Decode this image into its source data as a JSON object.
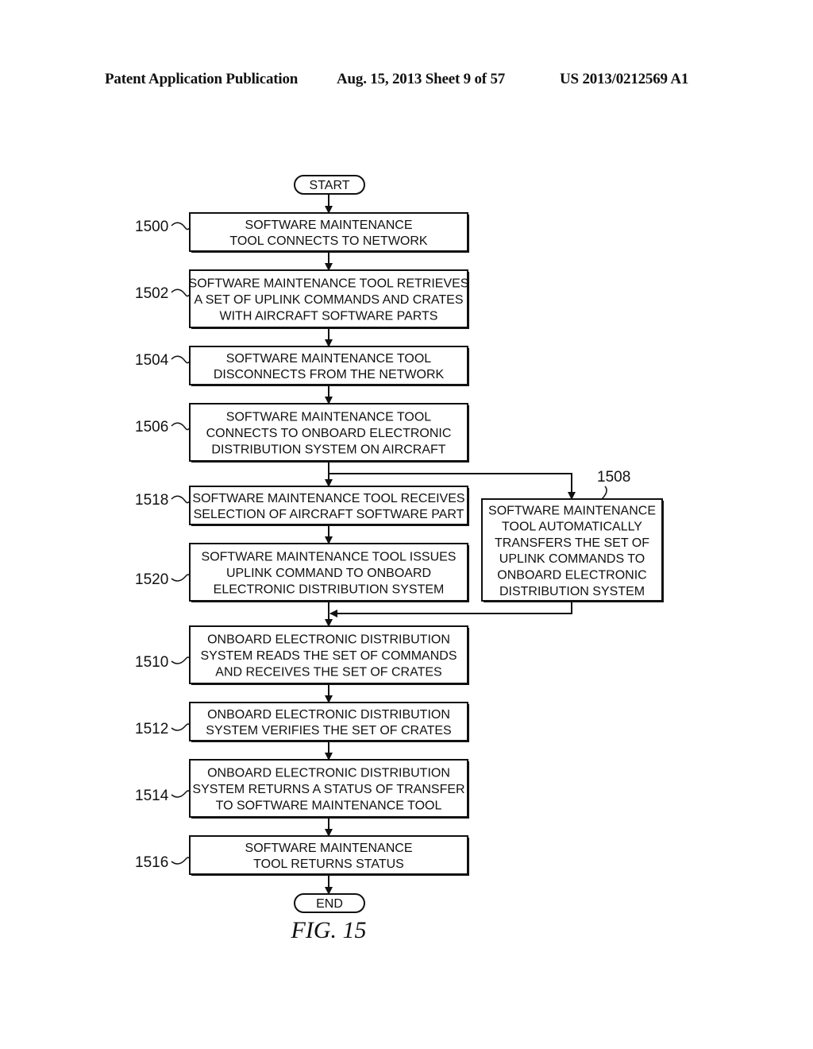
{
  "header": {
    "publication": "Patent Application Publication",
    "date_sheet": "Aug. 15, 2013  Sheet 9 of 57",
    "number": "US 2013/0212569 A1"
  },
  "figure_label": "FIG. 15",
  "terminals": {
    "start": "START",
    "end": "END"
  },
  "steps": [
    {
      "ref": "1500",
      "lines": [
        "SOFTWARE MAINTENANCE",
        "TOOL CONNECTS TO NETWORK"
      ]
    },
    {
      "ref": "1502",
      "lines": [
        "SOFTWARE MAINTENANCE TOOL RETRIEVES",
        "A SET OF UPLINK COMMANDS AND CRATES",
        "WITH AIRCRAFT SOFTWARE PARTS"
      ]
    },
    {
      "ref": "1504",
      "lines": [
        "SOFTWARE MAINTENANCE TOOL",
        "DISCONNECTS FROM THE NETWORK"
      ]
    },
    {
      "ref": "1506",
      "lines": [
        "SOFTWARE MAINTENANCE TOOL",
        "CONNECTS TO ONBOARD ELECTRONIC",
        "DISTRIBUTION SYSTEM ON AIRCRAFT"
      ]
    },
    {
      "ref": "1518",
      "lines": [
        "SOFTWARE MAINTENANCE TOOL RECEIVES",
        "SELECTION OF AIRCRAFT SOFTWARE PART"
      ]
    },
    {
      "ref": "1520",
      "lines": [
        "SOFTWARE MAINTENANCE TOOL ISSUES",
        "UPLINK COMMAND TO ONBOARD",
        "ELECTRONIC DISTRIBUTION SYSTEM"
      ]
    },
    {
      "ref": "1508",
      "lines": [
        "SOFTWARE MAINTENANCE",
        "TOOL AUTOMATICALLY",
        "TRANSFERS THE SET OF",
        "UPLINK COMMANDS TO",
        "ONBOARD ELECTRONIC",
        "DISTRIBUTION SYSTEM"
      ]
    },
    {
      "ref": "1510",
      "lines": [
        "ONBOARD ELECTRONIC DISTRIBUTION",
        "SYSTEM READS THE SET OF COMMANDS",
        "AND RECEIVES THE SET OF CRATES"
      ]
    },
    {
      "ref": "1512",
      "lines": [
        "ONBOARD ELECTRONIC DISTRIBUTION",
        "SYSTEM VERIFIES THE SET OF CRATES"
      ]
    },
    {
      "ref": "1514",
      "lines": [
        "ONBOARD ELECTRONIC DISTRIBUTION",
        "SYSTEM RETURNS A STATUS OF TRANSFER",
        "TO SOFTWARE MAINTENANCE TOOL"
      ]
    },
    {
      "ref": "1516",
      "lines": [
        "SOFTWARE MAINTENANCE",
        "TOOL RETURNS STATUS"
      ]
    }
  ]
}
